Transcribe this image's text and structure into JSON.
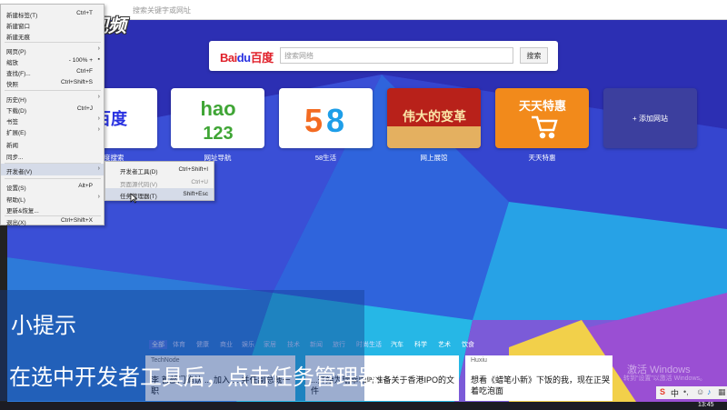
{
  "address": {
    "placeholder": "搜索关键字或网址"
  },
  "brand": "利dong视频",
  "search": {
    "logo_a": "Bai",
    "logo_b": "du",
    "logo_c": "百度",
    "placeholder": "搜索网络",
    "button": "搜索"
  },
  "tiles": [
    {
      "label": "百度搜索",
      "text": "百度"
    },
    {
      "label": "网址导航",
      "text": "hao 123"
    },
    {
      "label": "58生活",
      "text": "58"
    },
    {
      "label": "网上展馆",
      "text": "伟大的变革"
    },
    {
      "label": "天天特惠",
      "text": "天天特惠"
    },
    {
      "label": "",
      "text": "+ 添加网站"
    }
  ],
  "menu": [
    {
      "label": "新建标签(T)",
      "shortcut": "Ctrl+T"
    },
    {
      "label": "新建窗口",
      "shortcut": ""
    },
    {
      "label": "新建无痕",
      "shortcut": ""
    },
    {
      "label": "网页(P)",
      "shortcut": ""
    },
    {
      "label": "缩放",
      "shortcut": "- 100% +"
    },
    {
      "label": "查找(F)...",
      "shortcut": "Ctrl+F"
    },
    {
      "label": "快照",
      "shortcut": "Ctrl+Shift+S"
    },
    {
      "label": "历史(H)",
      "shortcut": ""
    },
    {
      "label": "下载(D)",
      "shortcut": "Ctrl+J"
    },
    {
      "label": "书签",
      "shortcut": ""
    },
    {
      "label": "扩展(E)",
      "shortcut": ""
    },
    {
      "label": "新闻",
      "shortcut": ""
    },
    {
      "label": "同步...",
      "shortcut": ""
    },
    {
      "label": "开发者(V)",
      "shortcut": ""
    },
    {
      "label": "设置(S)",
      "shortcut": "Alt+P"
    },
    {
      "label": "帮助(L)",
      "shortcut": ""
    },
    {
      "label": "更新&恢复...",
      "shortcut": ""
    },
    {
      "label": "退出(X)",
      "shortcut": "Ctrl+Shift+X"
    }
  ],
  "submenu": [
    {
      "label": "开发者工具(D)",
      "shortcut": "Ctrl+Shift+I"
    },
    {
      "label": "页面源代码(V)",
      "shortcut": "Ctrl+U"
    },
    {
      "label": "任务管理器(T)",
      "shortcut": "Shift+Esc"
    }
  ],
  "feed": {
    "tabs": [
      "全部",
      "体育",
      "健康",
      "商业",
      "娱乐",
      "家居",
      "技术",
      "新闻",
      "旅行",
      "时尚生活",
      "汽车",
      "科学",
      "艺术",
      "饮食"
    ],
    "cards": [
      {
        "source": "TechNode",
        "title": "李 首部门确认 ... 加入 ... 并任副总裁一职"
      },
      {
        "source": "",
        "title": "...开始为瑞幸咖啡准备关于香港IPO的文件"
      },
      {
        "source": "Huxiu",
        "title": "想看《蜡笔小新》下饭的我，现在正哭着吃泡面"
      }
    ]
  },
  "tips": {
    "title": "小提示",
    "text": "在选中开发者工具后，点击任务管理器"
  },
  "watermark": {
    "line1": "激活 Windows",
    "line2": "转到“设置”以激活 Windows。"
  },
  "tray": {
    "ime": "中",
    "clock": "13:45"
  }
}
